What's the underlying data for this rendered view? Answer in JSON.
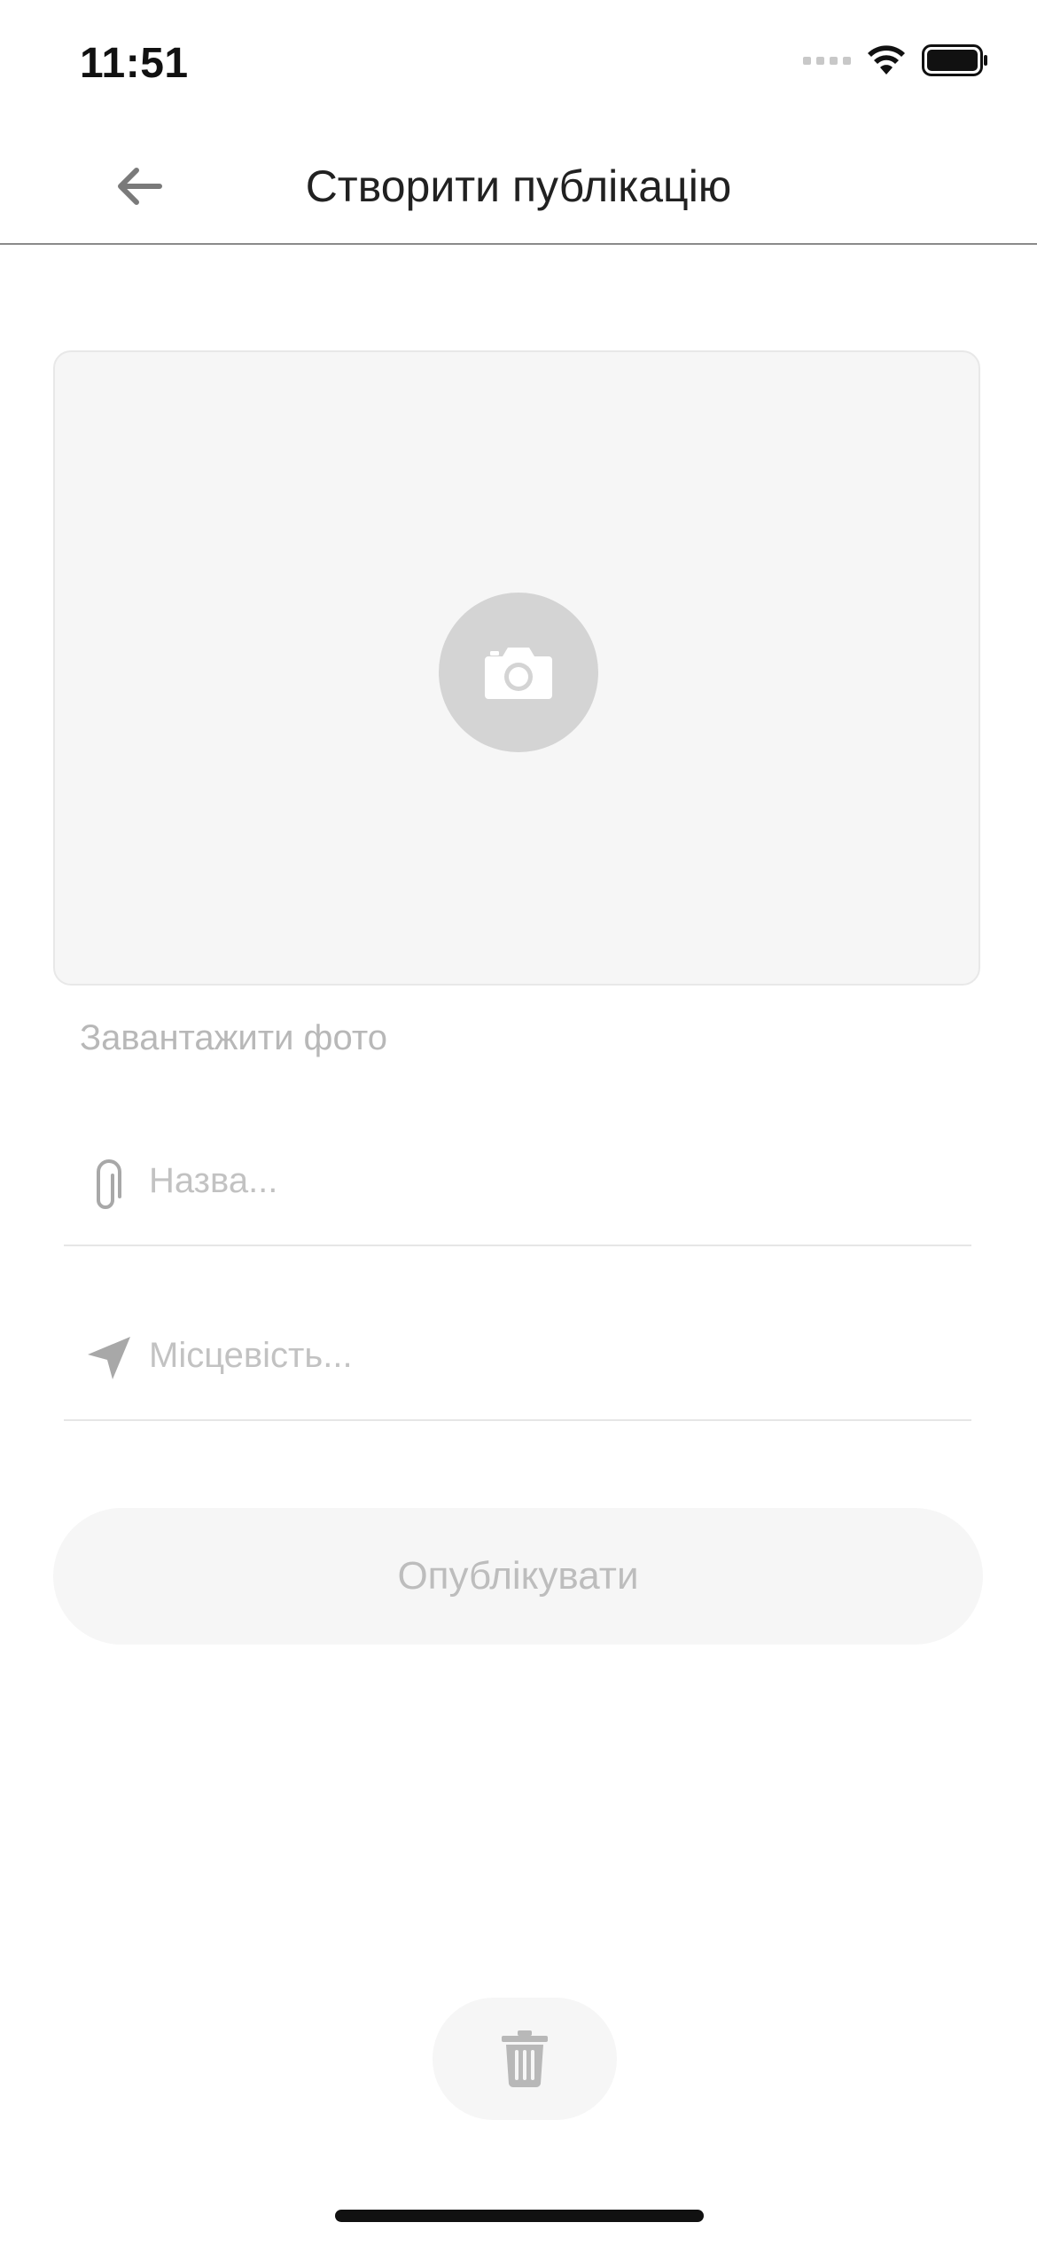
{
  "status_bar": {
    "time": "11:51"
  },
  "header": {
    "title": "Створити публікацію",
    "back_icon": "arrow-left-icon"
  },
  "photo_upload": {
    "icon": "camera-icon",
    "caption": "Завантажити фото"
  },
  "form": {
    "name_field": {
      "icon": "paperclip-icon",
      "placeholder": "Назва...",
      "value": ""
    },
    "location_field": {
      "icon": "location-arrow-icon",
      "placeholder": "Місцевість...",
      "value": ""
    },
    "publish_label": "Опублікувати"
  },
  "delete": {
    "icon": "trash-icon"
  },
  "colors": {
    "placeholder_text": "#c2c2c2",
    "muted_background": "#f6f6f6",
    "icon_gray": "#8a8a8a"
  }
}
